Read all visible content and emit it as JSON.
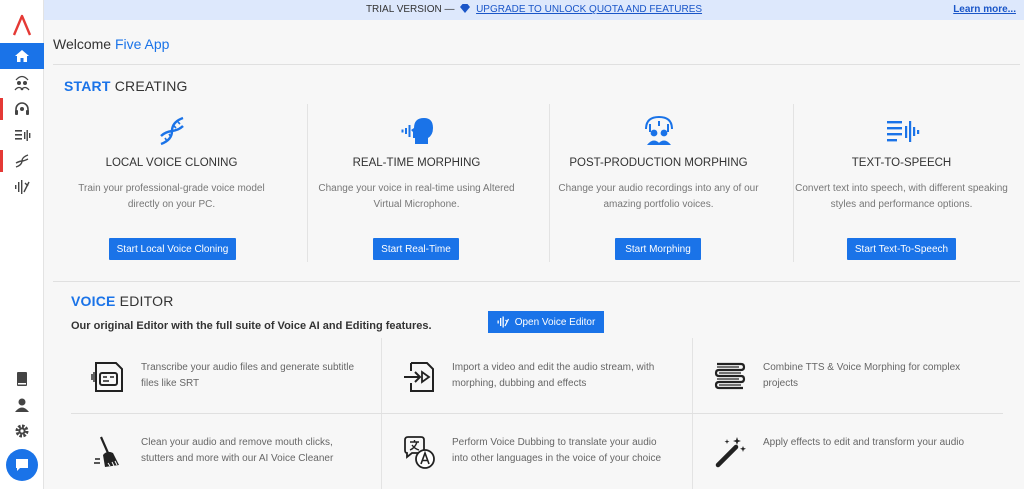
{
  "banner": {
    "trial": "TRIAL VERSION —",
    "upgrade": "UPGRADE TO UNLOCK QUOTA AND FEATURES",
    "learn_more": "Learn more..."
  },
  "header": {
    "welcome": "Welcome",
    "name": "Five App"
  },
  "start": {
    "title_accent": "START",
    "title_rest": "CREATING",
    "cards": [
      {
        "title": "LOCAL VOICE CLONING",
        "desc": "Train your professional-grade voice model directly on your PC.",
        "button": "Start Local Voice Cloning"
      },
      {
        "title": "REAL-TIME MORPHING",
        "desc": "Change your voice in real-time using Altered Virtual Microphone.",
        "button": "Start Real-Time"
      },
      {
        "title": "POST-PRODUCTION MORPHING",
        "desc": "Change your audio recordings into any of our amazing portfolio voices.",
        "button": "Start Morphing"
      },
      {
        "title": "TEXT-TO-SPEECH",
        "desc": "Convert text into speech, with different speaking styles and performance options.",
        "button": "Start Text-To-Speech"
      }
    ]
  },
  "editor": {
    "title_accent": "VOICE",
    "title_rest": "EDITOR",
    "subtitle": "Our original Editor with the full suite of Voice AI and Editing features.",
    "open_button": "Open Voice Editor",
    "features": [
      {
        "icon": "subtitle-icon",
        "text": "Transcribe your audio files and generate subtitle files like SRT"
      },
      {
        "icon": "import-video-icon",
        "text": "Import a video and edit the audio stream, with morphing, dubbing and effects"
      },
      {
        "icon": "layers-icon",
        "text": "Combine TTS & Voice Morphing for complex projects"
      },
      {
        "icon": "broom-icon",
        "text": "Clean your audio and remove mouth clicks, stutters and more with our AI Voice Cleaner"
      },
      {
        "icon": "translate-icon",
        "text": "Perform Voice Dubbing to translate your audio into other languages in the voice of your choice"
      },
      {
        "icon": "magic-wand-icon",
        "text": "Apply effects to edit and transform your audio"
      }
    ]
  },
  "colors": {
    "accent": "#1a73e8",
    "logo": "#e53935"
  }
}
